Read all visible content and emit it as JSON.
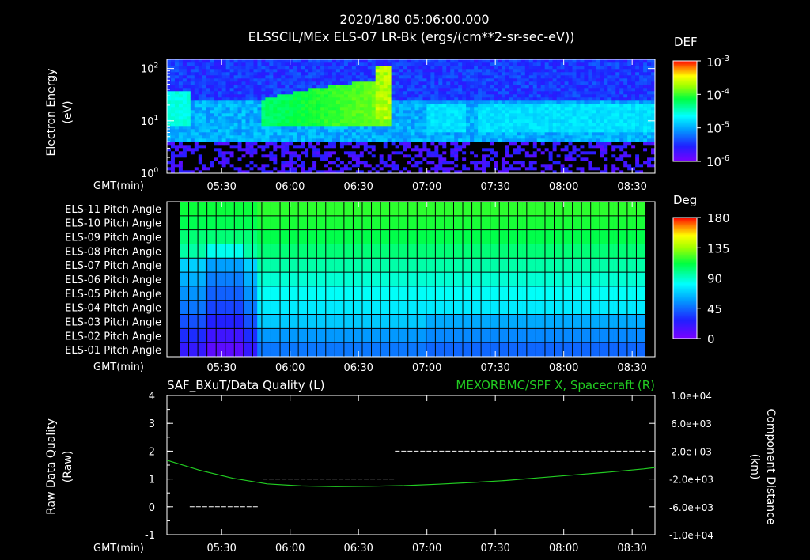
{
  "header": {
    "title_line1": "2020/180 05:06:00.000",
    "title_line2": "ELSSCIL/MEx ELS-07 LR-Bk  (ergs/(cm**2-sr-sec-eV))"
  },
  "colors": {
    "background": "#000000",
    "text": "#ffffff",
    "green_line": "#22cc22",
    "data_quality": "#ffffff"
  },
  "time_axis": {
    "label": "GMT(min)",
    "ticks": [
      "05:30",
      "06:00",
      "06:30",
      "07:00",
      "07:30",
      "08:00",
      "08:30"
    ],
    "start": "05:06",
    "end": "08:40"
  },
  "chart_data": [
    {
      "type": "heatmap",
      "name": "spectrogram",
      "ylabel": "Electron Energy (eV)",
      "ylabel_line1": "Electron Energy",
      "ylabel_line2": "(eV)",
      "y_scale": "log",
      "ylim": [
        1,
        150
      ],
      "yticks": [
        {
          "base": "10",
          "exp": "0",
          "value": 1
        },
        {
          "base": "10",
          "exp": "1",
          "value": 10
        },
        {
          "base": "10",
          "exp": "2",
          "value": 100
        }
      ],
      "colorbar": {
        "title": "DEF",
        "scale": "log",
        "range": [
          1e-06,
          0.001
        ],
        "ticks": [
          {
            "base": "10",
            "exp": "-3"
          },
          {
            "base": "10",
            "exp": "-4"
          },
          {
            "base": "10",
            "exp": "-5"
          },
          {
            "base": "10",
            "exp": "-6"
          }
        ]
      },
      "features": [
        {
          "time_range": [
            "05:06",
            "05:16"
          ],
          "energy_band_eV": [
            8,
            35
          ],
          "level": "high-cyan"
        },
        {
          "time_range": [
            "05:47",
            "06:43"
          ],
          "energy_band_eV": [
            8,
            60
          ],
          "level": "green-rising"
        },
        {
          "time_range": [
            "06:38",
            "06:44"
          ],
          "energy_band_eV": [
            10,
            110
          ],
          "level": "peak"
        }
      ]
    },
    {
      "type": "heatmap",
      "name": "pitch-angle",
      "rows": [
        "ELS-11 Pitch Angle",
        "ELS-10 Pitch Angle",
        "ELS-09 Pitch Angle",
        "ELS-08 Pitch Angle",
        "ELS-07 Pitch Angle",
        "ELS-06 Pitch Angle",
        "ELS-05 Pitch Angle",
        "ELS-04 Pitch Angle",
        "ELS-03 Pitch Angle",
        "ELS-02 Pitch Angle",
        "ELS-01 Pitch Angle"
      ],
      "row_values_deg": [
        118,
        115,
        110,
        103,
        95,
        88,
        82,
        76,
        68,
        60,
        52
      ],
      "colorbar": {
        "title": "Deg",
        "range": [
          0,
          180
        ],
        "ticks": [
          "180",
          "135",
          "90",
          "45",
          "0"
        ]
      }
    },
    {
      "type": "line",
      "name": "data-quality-and-position",
      "title_left": "SAF_BXuT/Data Quality (L)",
      "title_right": "MEXORBMC/SPF X, Spacecraft (R)",
      "ylabel_left_line1": "Raw Data Quality",
      "ylabel_left_line2": "(Raw)",
      "ylabel_right_line1": "Component Distance",
      "ylabel_right_line2": "(km)",
      "ylim_left": [
        -1,
        4
      ],
      "yticks_left": [
        "4",
        "3",
        "2",
        "1",
        "0",
        "-1"
      ],
      "ylim_right": [
        -10000,
        10000
      ],
      "yticks_right": [
        "1.0e+04",
        "6.0e+03",
        "2.0e+03",
        "-2.0e+03",
        "-6.0e+03",
        "-1.0e+04"
      ],
      "series": [
        {
          "name": "SAF_BXuT/Data Quality",
          "axis": "left",
          "segments": [
            {
              "t": [
                "05:16",
                "05:46"
              ],
              "value": 0
            },
            {
              "t": [
                "05:48",
                "06:46"
              ],
              "value": 1
            },
            {
              "t": [
                "06:46",
                "08:36"
              ],
              "value": 2
            }
          ]
        },
        {
          "name": "MEXORBMC/SPF X, Spacecraft",
          "axis": "right",
          "t": [
            "05:06",
            "05:20",
            "05:35",
            "05:50",
            "06:05",
            "06:20",
            "06:35",
            "06:50",
            "07:05",
            "07:20",
            "07:35",
            "07:50",
            "08:05",
            "08:20",
            "08:35",
            "08:40"
          ],
          "values": [
            700,
            -700,
            -1900,
            -2700,
            -3000,
            -3100,
            -3050,
            -2950,
            -2750,
            -2500,
            -2200,
            -1800,
            -1400,
            -1000,
            -550,
            -350
          ]
        }
      ]
    }
  ]
}
